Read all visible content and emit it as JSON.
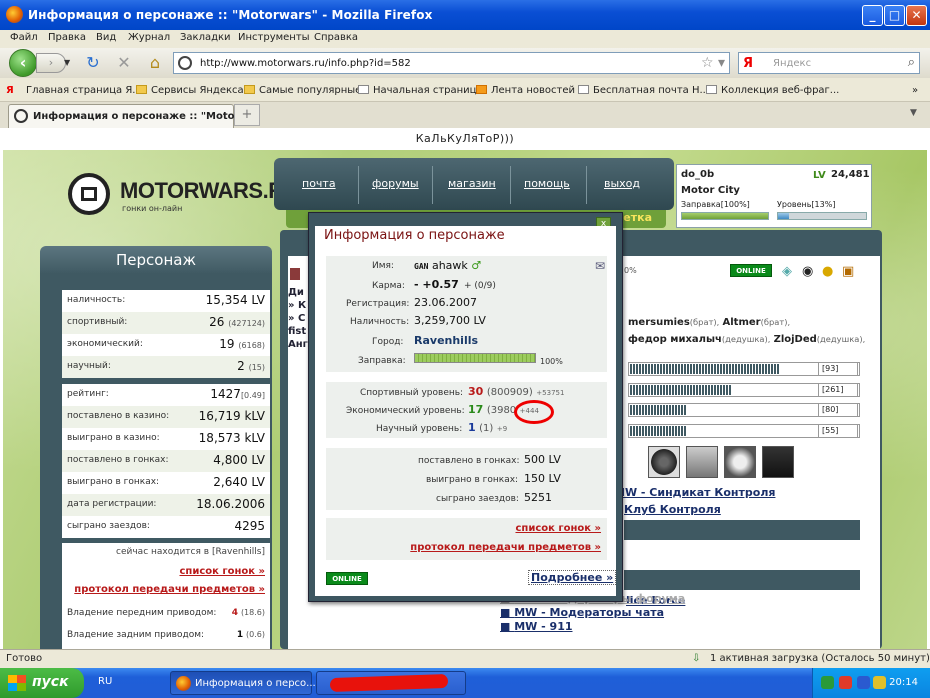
{
  "window": {
    "title": "Информация о персонаже :: \"Motorwars\" - Mozilla Firefox"
  },
  "menu": [
    "Файл",
    "Правка",
    "Вид",
    "Журнал",
    "Закладки",
    "Инструменты",
    "Справка"
  ],
  "nav": {
    "url": "http://www.motorwars.ru/info.php?id=582",
    "search_placeholder": "Яндекс",
    "search_logo": "Я"
  },
  "bookmarks": [
    "Главная страница Я...",
    "Сервисы Яндекса",
    "Самые популярные",
    "Начальная страница",
    "Лента новостей",
    "Бесплатная почта Н...",
    "Коллекция веб-фраг..."
  ],
  "tab": {
    "label": "Информация о персонаже :: \"Motor...",
    "new": "+"
  },
  "page": {
    "calc_text": "КаЛьКуЛяТоР)))",
    "logo": {
      "name": "MOTORWARS.RU",
      "sub": "гонки он-лайн"
    },
    "topnav": [
      "почта",
      "форумы",
      "магазин",
      "помощь",
      "выход"
    ],
    "greenbar_label": "ветка",
    "user": {
      "name": "do_0b",
      "city": "Motor City",
      "lv_label": "LV",
      "money": "24,481",
      "fuel_label": "Заправка[100%]",
      "fuel": 1.0,
      "level_label": "Уровень[13%]",
      "level": 0.13
    },
    "left": {
      "title": "Персонаж",
      "stats": [
        {
          "k": "наличность:",
          "v": "15,354 LV",
          "s": ""
        },
        {
          "k": "спортивный:",
          "v": "26",
          "s": "(427124)"
        },
        {
          "k": "экономический:",
          "v": "19",
          "s": "(6168)"
        },
        {
          "k": "научный:",
          "v": "2",
          "s": "(15)"
        }
      ],
      "stats2": [
        {
          "k": "рейтинг:",
          "v": "1427",
          "s": "[0.49]"
        },
        {
          "k": "поставлено в казино:",
          "v": "16,719 kLV",
          "s": ""
        },
        {
          "k": "выиграно в казино:",
          "v": "18,573 kLV",
          "s": ""
        },
        {
          "k": "поставлено в гонках:",
          "v": "4,800 LV",
          "s": ""
        },
        {
          "k": "выиграно в гонках:",
          "v": "2,640 LV",
          "s": ""
        },
        {
          "k": "дата регистрации:",
          "v": "18.06.2006",
          "s": ""
        },
        {
          "k": "сыграно заездов:",
          "v": "4295",
          "s": ""
        }
      ],
      "location": "сейчас находится в [Ravenhills]",
      "link1": "список гонок »",
      "link2": "протокол передачи предметов »",
      "drive": [
        {
          "k": "Владение передним приводом:",
          "v": "4",
          "s": "(18.6)"
        },
        {
          "k": "Владение задним приводом:",
          "v": "1",
          "s": "(0.6)"
        }
      ]
    },
    "right": {
      "online": "ONLINE",
      "percent_fragment": "0%",
      "names": [
        {
          "n": "mersumies",
          "r": "(брат),"
        },
        {
          "n": "Altmer",
          "r": "(брат),"
        },
        {
          "n": "федор михалыч",
          "r": "(дедушка),"
        },
        {
          "n": "ZlojDed",
          "r": "(дедушка),"
        }
      ],
      "bars": [
        {
          "label": "[93]",
          "fill": 0.8
        },
        {
          "label": "[261]",
          "fill": 0.55
        },
        {
          "label": "[80]",
          "fill": 0.3
        },
        {
          "label": "[55]",
          "fill": 0.3
        }
      ],
      "clubs": [
        "MW - Синдикат Контроля",
        "Клуб Контроля"
      ],
      "police": "lice Force",
      "mods": [
        "MW - Модераторы форума",
        "MW - Модераторы чата",
        "MW - 911"
      ],
      "frag": [
        "Ди",
        "» К",
        "» С",
        "fist",
        "Анг"
      ]
    },
    "popup": {
      "title": "Информация о персонаже",
      "close": "x",
      "rows": [
        {
          "k": "Имя:",
          "v": "ahawk",
          "prefix": "GAN"
        },
        {
          "k": "Карма:",
          "v": "- +0.57",
          "s": "+ (0/9)"
        },
        {
          "k": "Регистрация:",
          "v": "23.06.2007"
        },
        {
          "k": "Наличность:",
          "v": "3,259,700 LV"
        },
        {
          "k": "Город:",
          "v": "Ravenhills"
        },
        {
          "k": "Заправка:",
          "v": "100%"
        }
      ],
      "fuel": 1.0,
      "levels": [
        {
          "k": "Спортивный уровень:",
          "v": "30",
          "s": "(800909)",
          "d": "+53751"
        },
        {
          "k": "Экономический уровень:",
          "v": "17",
          "s": "(3980",
          "d": "+444"
        },
        {
          "k": "Научный уровень:",
          "v": "1",
          "s": "(1)",
          "d": "+9"
        }
      ],
      "stats": [
        {
          "k": "поставлено в гонках:",
          "v": "500 LV"
        },
        {
          "k": "выиграно в гонках:",
          "v": "150 LV"
        },
        {
          "k": "сыграно заездов:",
          "v": "5251"
        }
      ],
      "link1": "список гонок »",
      "link2": "протокол передачи предметов »",
      "online": "ONLINE",
      "more": "Подробнее »"
    }
  },
  "status": {
    "left": "Готово",
    "right": "1 активная загрузка (Осталось 50 минут)"
  },
  "taskbar": {
    "start": "пуск",
    "lang": "RU",
    "app": "Информация о персо...",
    "time": "20:14"
  },
  "colors": {
    "accent_green": "#6fa03a",
    "panel": "#3f5962",
    "link_red": "#b81a1a",
    "circle_red": "#e00000"
  }
}
